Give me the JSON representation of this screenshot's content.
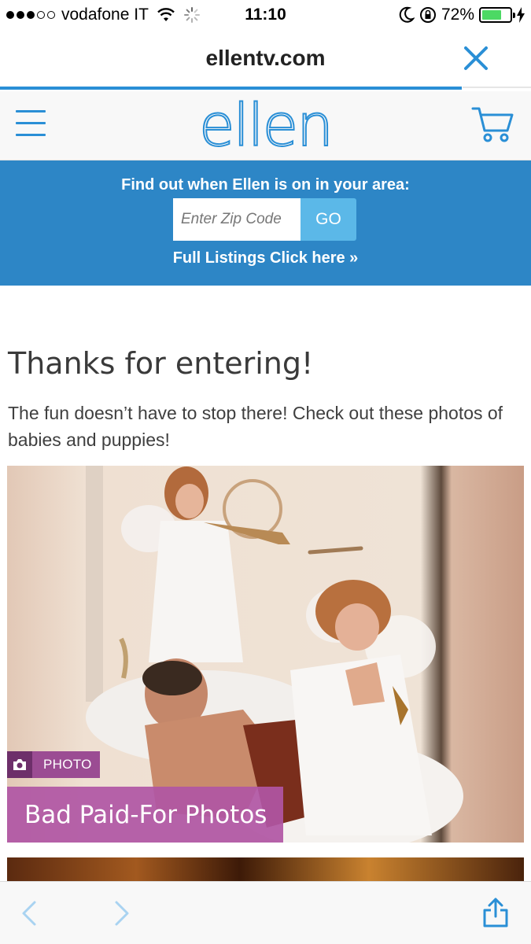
{
  "status_bar": {
    "carrier": "vodafone IT",
    "time": "11:10",
    "battery_percent": "72%",
    "battery_level": 0.72,
    "signal_bars_filled": 3,
    "signal_bars_total": 5
  },
  "browser": {
    "url": "ellentv.com",
    "load_progress": 0.87
  },
  "site": {
    "logo_text": "ellen",
    "brand_color": "#2a8fd6"
  },
  "zip_banner": {
    "title": "Find out when Ellen is on in your area:",
    "zip_placeholder": "Enter Zip Code",
    "go_label": "GO",
    "listings_link": "Full Listings Click here »",
    "banner_color": "#2d86c6"
  },
  "content": {
    "headline": "Thanks for entering!",
    "subtext": "The fun doesn’t have to stop there! Check out these photos of babies and puppies!"
  },
  "photo_card": {
    "tag_label": "PHOTO",
    "title": "Bad Paid-For Photos",
    "tag_color": "#9b4c93",
    "title_color": "#b056a4"
  },
  "icons": {
    "menu": "hamburger-icon",
    "cart": "cart-icon",
    "close": "close-icon",
    "camera": "camera-icon",
    "back": "chevron-left-icon",
    "forward": "chevron-right-icon",
    "share": "share-icon",
    "wifi": "wifi-icon",
    "moon": "moon-icon",
    "rotation_lock": "rotation-lock-icon",
    "charging": "charging-bolt-icon"
  }
}
